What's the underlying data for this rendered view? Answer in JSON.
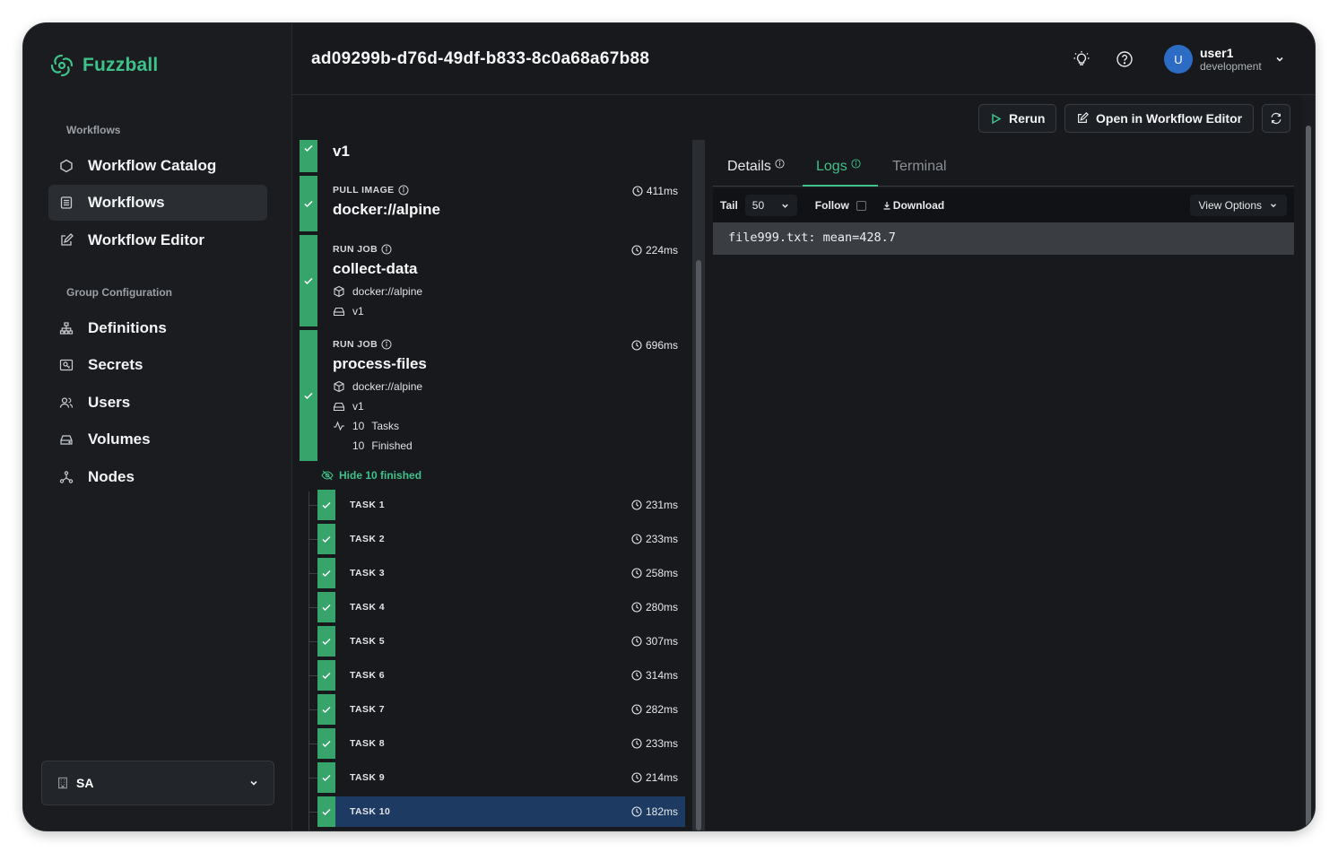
{
  "app": {
    "name": "Fuzzball",
    "brand_color": "#3fc28a"
  },
  "sidebar": {
    "sections": [
      {
        "label": "Workflows",
        "items": [
          {
            "label": "Workflow Catalog",
            "icon": "hexagon-icon"
          },
          {
            "label": "Workflows",
            "icon": "document-icon",
            "active": true
          },
          {
            "label": "Workflow Editor",
            "icon": "edit-icon"
          }
        ]
      },
      {
        "label": "Group Configuration",
        "items": [
          {
            "label": "Definitions",
            "icon": "sitemap-icon"
          },
          {
            "label": "Secrets",
            "icon": "key-card-icon"
          },
          {
            "label": "Users",
            "icon": "users-icon"
          },
          {
            "label": "Volumes",
            "icon": "drive-icon"
          },
          {
            "label": "Nodes",
            "icon": "nodes-icon"
          }
        ]
      }
    ],
    "org_selector": {
      "label": "SA",
      "icon": "building-icon"
    }
  },
  "header": {
    "run_id": "ad09299b-d76d-49df-b833-8c0a68a67b88",
    "user": {
      "initial": "U",
      "name": "user1",
      "environment": "development"
    }
  },
  "toolbar": {
    "rerun_label": "Rerun",
    "open_editor_label": "Open in Workflow Editor"
  },
  "workflow": {
    "root": {
      "name": "v1"
    },
    "steps": [
      {
        "type": "PULL IMAGE",
        "name": "docker://alpine",
        "duration": "411ms"
      },
      {
        "type": "RUN JOB",
        "name": "collect-data",
        "duration": "224ms",
        "image": "docker://alpine",
        "version": "v1"
      },
      {
        "type": "RUN JOB",
        "name": "process-files",
        "duration": "696ms",
        "image": "docker://alpine",
        "version": "v1",
        "tasks_count": "10",
        "tasks_label": "Tasks",
        "finished_count": "10",
        "finished_label": "Finished"
      }
    ],
    "hide_finished_label": "Hide 10 finished",
    "tasks": [
      {
        "name": "TASK 1",
        "duration": "231ms"
      },
      {
        "name": "TASK 2",
        "duration": "233ms"
      },
      {
        "name": "TASK 3",
        "duration": "258ms"
      },
      {
        "name": "TASK 4",
        "duration": "280ms"
      },
      {
        "name": "TASK 5",
        "duration": "307ms"
      },
      {
        "name": "TASK 6",
        "duration": "314ms"
      },
      {
        "name": "TASK 7",
        "duration": "282ms"
      },
      {
        "name": "TASK 8",
        "duration": "233ms"
      },
      {
        "name": "TASK 9",
        "duration": "214ms"
      },
      {
        "name": "TASK 10",
        "duration": "182ms",
        "selected": true
      }
    ]
  },
  "panel": {
    "tabs": [
      {
        "label": "Details",
        "info": true
      },
      {
        "label": "Logs",
        "info": true,
        "active": true
      },
      {
        "label": "Terminal",
        "info": false
      }
    ],
    "logs": {
      "tail_label": "Tail",
      "tail_value": "50",
      "follow_label": "Follow",
      "download_label": "Download",
      "view_options_label": "View Options",
      "lines": [
        "file999.txt: mean=428.7"
      ]
    }
  },
  "colors": {
    "success": "#36a46b",
    "selected_row": "#1d3a63",
    "avatar": "#2c6cc4"
  }
}
